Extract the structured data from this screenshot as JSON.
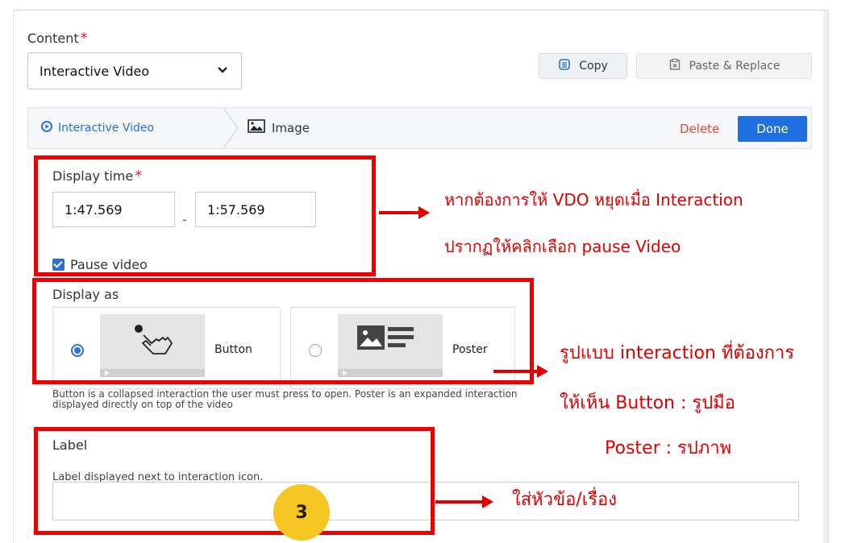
{
  "content": {
    "label": "Content",
    "required_mark": "*",
    "select_value": "Interactive Video",
    "copy_label": "Copy",
    "paste_label": "Paste & Replace"
  },
  "subbar": {
    "tab_interactive": "Interactive Video",
    "tab_image": "Image",
    "delete_label": "Delete",
    "done_label": "Done"
  },
  "display_time": {
    "label": "Display time",
    "required_mark": "*",
    "start": "1:47.569",
    "separator": "-",
    "end": "1:57.569",
    "pause_label": "Pause video",
    "pause_checked": true
  },
  "display_as": {
    "label": "Display as",
    "options": [
      {
        "label": "Button",
        "selected": true,
        "icon": "hand-pointer-icon"
      },
      {
        "label": "Poster",
        "selected": false,
        "icon": "image-text-icon"
      }
    ],
    "help_line1": "Button is a collapsed interaction the user must press to open. Poster is an expanded interaction",
    "help_line2": "displayed directly on top of the video"
  },
  "label_field": {
    "label": "Label",
    "help": "Label displayed next to interaction icon.",
    "value": ""
  },
  "annotations": {
    "pause_line1": "หากต้องการให้ VDO หยุดเมื่อ Interaction",
    "pause_line2": "ปรากฏให้คลิกเลือก pause Video",
    "display_line1": "รูปแบบ interaction ที่ต้องการ",
    "display_line2": "ให้เห็น Button : รูปมือ",
    "display_line3": "Poster : รปภาพ",
    "label_line1": "ใส่หัวข้อ/เรื่อง",
    "step_number": "3"
  },
  "colors": {
    "accent_blue": "#2f6fd8",
    "done_blue": "#1f6fe0",
    "annotation_red": "#ee0000",
    "badge_yellow": "#f7c623",
    "delete_red": "#e34a3a"
  }
}
